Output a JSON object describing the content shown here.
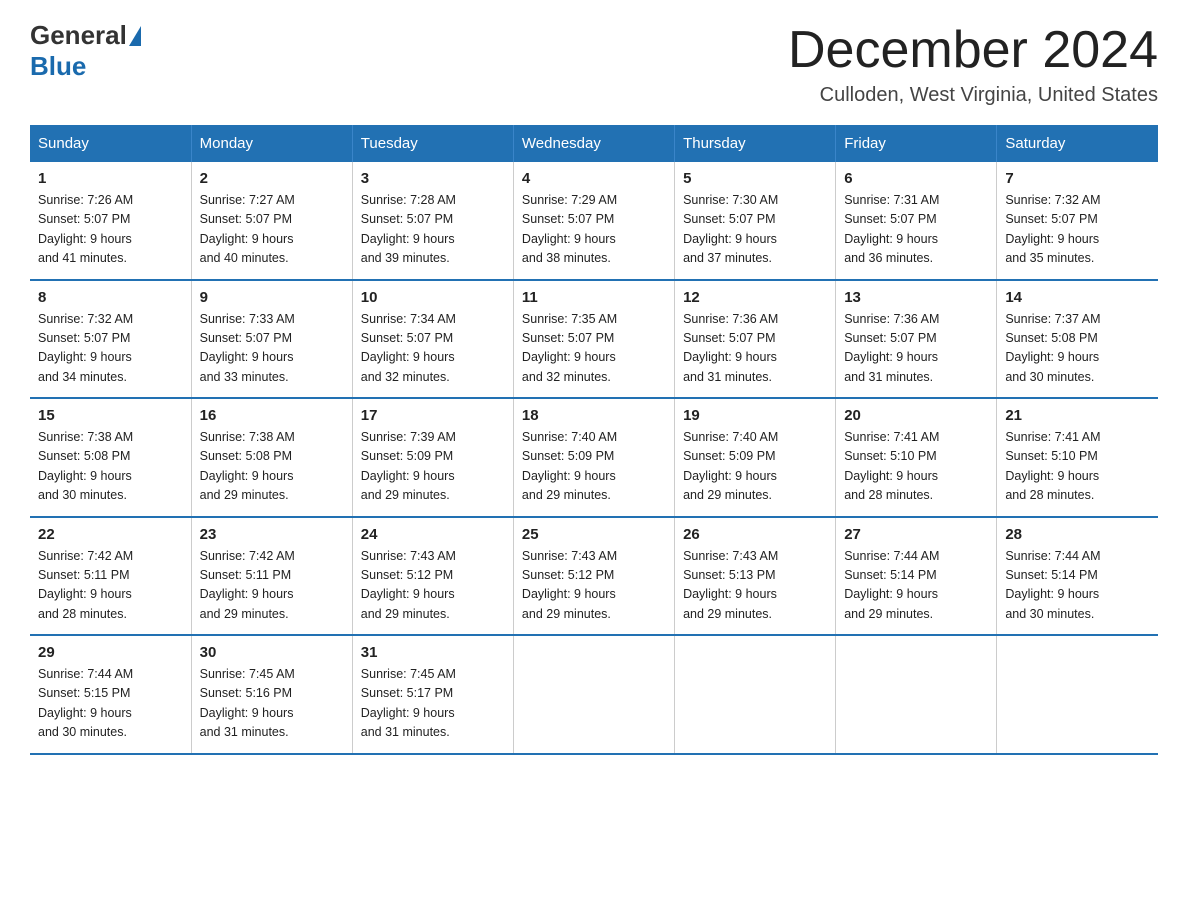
{
  "logo": {
    "general": "General",
    "blue": "Blue"
  },
  "title": "December 2024",
  "location": "Culloden, West Virginia, United States",
  "days_of_week": [
    "Sunday",
    "Monday",
    "Tuesday",
    "Wednesday",
    "Thursday",
    "Friday",
    "Saturday"
  ],
  "weeks": [
    [
      {
        "day": "1",
        "sunrise": "7:26 AM",
        "sunset": "5:07 PM",
        "daylight": "9 hours and 41 minutes."
      },
      {
        "day": "2",
        "sunrise": "7:27 AM",
        "sunset": "5:07 PM",
        "daylight": "9 hours and 40 minutes."
      },
      {
        "day": "3",
        "sunrise": "7:28 AM",
        "sunset": "5:07 PM",
        "daylight": "9 hours and 39 minutes."
      },
      {
        "day": "4",
        "sunrise": "7:29 AM",
        "sunset": "5:07 PM",
        "daylight": "9 hours and 38 minutes."
      },
      {
        "day": "5",
        "sunrise": "7:30 AM",
        "sunset": "5:07 PM",
        "daylight": "9 hours and 37 minutes."
      },
      {
        "day": "6",
        "sunrise": "7:31 AM",
        "sunset": "5:07 PM",
        "daylight": "9 hours and 36 minutes."
      },
      {
        "day": "7",
        "sunrise": "7:32 AM",
        "sunset": "5:07 PM",
        "daylight": "9 hours and 35 minutes."
      }
    ],
    [
      {
        "day": "8",
        "sunrise": "7:32 AM",
        "sunset": "5:07 PM",
        "daylight": "9 hours and 34 minutes."
      },
      {
        "day": "9",
        "sunrise": "7:33 AM",
        "sunset": "5:07 PM",
        "daylight": "9 hours and 33 minutes."
      },
      {
        "day": "10",
        "sunrise": "7:34 AM",
        "sunset": "5:07 PM",
        "daylight": "9 hours and 32 minutes."
      },
      {
        "day": "11",
        "sunrise": "7:35 AM",
        "sunset": "5:07 PM",
        "daylight": "9 hours and 32 minutes."
      },
      {
        "day": "12",
        "sunrise": "7:36 AM",
        "sunset": "5:07 PM",
        "daylight": "9 hours and 31 minutes."
      },
      {
        "day": "13",
        "sunrise": "7:36 AM",
        "sunset": "5:07 PM",
        "daylight": "9 hours and 31 minutes."
      },
      {
        "day": "14",
        "sunrise": "7:37 AM",
        "sunset": "5:08 PM",
        "daylight": "9 hours and 30 minutes."
      }
    ],
    [
      {
        "day": "15",
        "sunrise": "7:38 AM",
        "sunset": "5:08 PM",
        "daylight": "9 hours and 30 minutes."
      },
      {
        "day": "16",
        "sunrise": "7:38 AM",
        "sunset": "5:08 PM",
        "daylight": "9 hours and 29 minutes."
      },
      {
        "day": "17",
        "sunrise": "7:39 AM",
        "sunset": "5:09 PM",
        "daylight": "9 hours and 29 minutes."
      },
      {
        "day": "18",
        "sunrise": "7:40 AM",
        "sunset": "5:09 PM",
        "daylight": "9 hours and 29 minutes."
      },
      {
        "day": "19",
        "sunrise": "7:40 AM",
        "sunset": "5:09 PM",
        "daylight": "9 hours and 29 minutes."
      },
      {
        "day": "20",
        "sunrise": "7:41 AM",
        "sunset": "5:10 PM",
        "daylight": "9 hours and 28 minutes."
      },
      {
        "day": "21",
        "sunrise": "7:41 AM",
        "sunset": "5:10 PM",
        "daylight": "9 hours and 28 minutes."
      }
    ],
    [
      {
        "day": "22",
        "sunrise": "7:42 AM",
        "sunset": "5:11 PM",
        "daylight": "9 hours and 28 minutes."
      },
      {
        "day": "23",
        "sunrise": "7:42 AM",
        "sunset": "5:11 PM",
        "daylight": "9 hours and 29 minutes."
      },
      {
        "day": "24",
        "sunrise": "7:43 AM",
        "sunset": "5:12 PM",
        "daylight": "9 hours and 29 minutes."
      },
      {
        "day": "25",
        "sunrise": "7:43 AM",
        "sunset": "5:12 PM",
        "daylight": "9 hours and 29 minutes."
      },
      {
        "day": "26",
        "sunrise": "7:43 AM",
        "sunset": "5:13 PM",
        "daylight": "9 hours and 29 minutes."
      },
      {
        "day": "27",
        "sunrise": "7:44 AM",
        "sunset": "5:14 PM",
        "daylight": "9 hours and 29 minutes."
      },
      {
        "day": "28",
        "sunrise": "7:44 AM",
        "sunset": "5:14 PM",
        "daylight": "9 hours and 30 minutes."
      }
    ],
    [
      {
        "day": "29",
        "sunrise": "7:44 AM",
        "sunset": "5:15 PM",
        "daylight": "9 hours and 30 minutes."
      },
      {
        "day": "30",
        "sunrise": "7:45 AM",
        "sunset": "5:16 PM",
        "daylight": "9 hours and 31 minutes."
      },
      {
        "day": "31",
        "sunrise": "7:45 AM",
        "sunset": "5:17 PM",
        "daylight": "9 hours and 31 minutes."
      },
      null,
      null,
      null,
      null
    ]
  ],
  "labels": {
    "sunrise": "Sunrise:",
    "sunset": "Sunset:",
    "daylight": "Daylight:"
  }
}
